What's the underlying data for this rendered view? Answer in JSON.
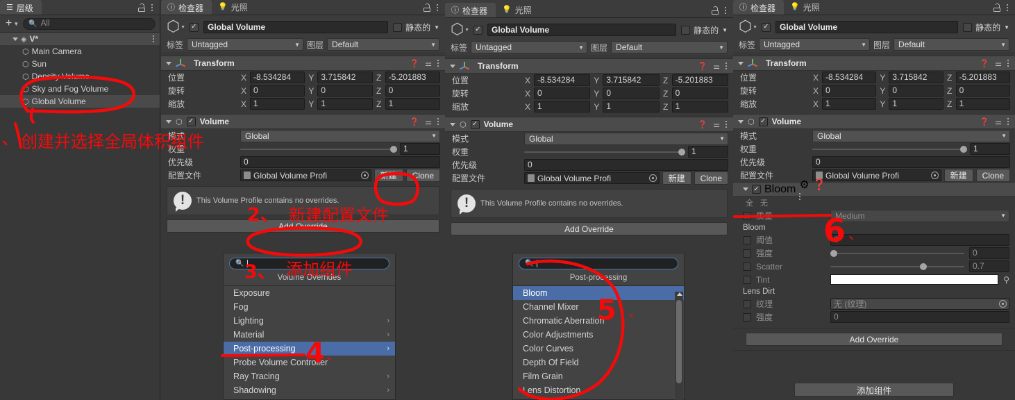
{
  "hierarchy": {
    "tab_label": "层级",
    "add_label": "+",
    "search_placeholder": "All",
    "scene_name": "V*",
    "items": [
      {
        "label": "Main Camera",
        "selected": false
      },
      {
        "label": "Sun",
        "selected": false
      },
      {
        "label": "Density Volume",
        "selected": false
      },
      {
        "label": "Sky and Fog Volume",
        "selected": false
      },
      {
        "label": "Global Volume",
        "selected": true
      }
    ]
  },
  "inspector": {
    "tab_inspector": "检查器",
    "tab_lighting": "光照",
    "object_name": "Global Volume",
    "static_label": "静态的",
    "tag_label": "标签",
    "tag_value": "Untagged",
    "layer_label": "图层",
    "layer_value": "Default",
    "transform": {
      "title": "Transform",
      "position_label": "位置",
      "rotation_label": "旋转",
      "scale_label": "缩放",
      "axis": [
        "X",
        "Y",
        "Z"
      ],
      "position": [
        "-8.534284",
        "3.715842",
        "-5.201883"
      ],
      "rotation": [
        "0",
        "0",
        "0"
      ],
      "scale": [
        "1",
        "1",
        "1"
      ]
    },
    "volume": {
      "title": "Volume",
      "mode_label": "模式",
      "mode_value": "Global",
      "weight_label": "权重",
      "weight_value": "1",
      "priority_label": "优先级",
      "priority_value": "0",
      "profile_label": "配置文件",
      "profile_value": "Global Volume Profi",
      "new_button": "新建",
      "clone_button": "Clone",
      "no_overrides_text": "This Volume Profile contains no overrides.",
      "add_override_button": "Add Override"
    },
    "add_component_button": "添加组件"
  },
  "overrides_popup": {
    "search_placeholder": "",
    "title": "Volume Overrides",
    "items": [
      {
        "label": "Exposure",
        "has_sub": false,
        "selected": false
      },
      {
        "label": "Fog",
        "has_sub": false,
        "selected": false
      },
      {
        "label": "Lighting",
        "has_sub": true,
        "selected": false
      },
      {
        "label": "Material",
        "has_sub": true,
        "selected": false
      },
      {
        "label": "Post-processing",
        "has_sub": true,
        "selected": true
      },
      {
        "label": "Probe Volume Controller",
        "has_sub": false,
        "selected": false
      },
      {
        "label": "Ray Tracing",
        "has_sub": true,
        "selected": false
      },
      {
        "label": "Shadowing",
        "has_sub": true,
        "selected": false
      }
    ]
  },
  "postprocessing_popup": {
    "search_placeholder": "",
    "title": "Post-processing",
    "items": [
      {
        "label": "Bloom",
        "selected": true
      },
      {
        "label": "Channel Mixer",
        "selected": false
      },
      {
        "label": "Chromatic Aberration",
        "selected": false
      },
      {
        "label": "Color Adjustments",
        "selected": false
      },
      {
        "label": "Color Curves",
        "selected": false
      },
      {
        "label": "Depth Of Field",
        "selected": false
      },
      {
        "label": "Film Grain",
        "selected": false
      },
      {
        "label": "Lens Distortion",
        "selected": false
      }
    ]
  },
  "bloom": {
    "title": "Bloom",
    "all_label": "全",
    "none_label": "无",
    "quality_label": "质量",
    "quality_value": "Medium",
    "section_bloom": "Bloom",
    "threshold_label": "阈值",
    "threshold_value": "0",
    "intensity_label": "强度",
    "intensity_value": "0",
    "scatter_label": "Scatter",
    "scatter_value": "0.7",
    "tint_label": "Tint",
    "tint_color": "#ffffff",
    "section_lens_dirt": "Lens Dirt",
    "texture_label": "纹理",
    "texture_value": "无 (纹理)",
    "dirt_intensity_label": "强度",
    "dirt_intensity_value": "0"
  },
  "annotations": [
    {
      "id": "step1",
      "text": "1、创建并选择全局体积组件"
    },
    {
      "id": "step2",
      "text": "2、新建配置文件"
    },
    {
      "id": "step3",
      "text": "3、添加组件"
    },
    {
      "id": "step4",
      "text": "4、"
    },
    {
      "id": "step5",
      "text": "5、"
    },
    {
      "id": "step6",
      "text": "6、"
    }
  ],
  "colors": {
    "accent_selection": "#4a6da7",
    "annotation_red": "#f00a0a",
    "panel_bg": "#383838",
    "header_bg": "#4b4b4b"
  }
}
